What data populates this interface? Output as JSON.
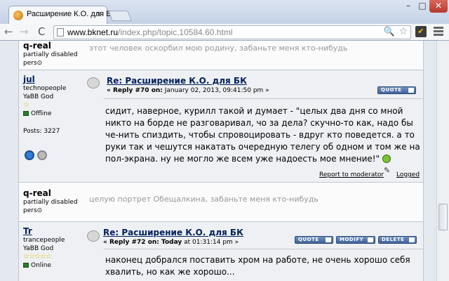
{
  "browser": {
    "tab_title": "Расширение К.О. для БК",
    "tab_close": "×",
    "win_min": "–",
    "win_max": "□",
    "win_close": "✕",
    "url_host": "www.bknet.ru",
    "url_path": "/index.php/topic,10584.60.html",
    "nav_back": "←",
    "nav_forward": "→",
    "nav_reload": "C",
    "zoom_glyph": "🔍",
    "star_glyph": "☆",
    "ext_glyph": "✔"
  },
  "posts": [
    {
      "username": "q-real",
      "line1": "partially disabled",
      "line2": "pers",
      "ignored_text": "этот человек оскорбил мою родину, забаньте меня кто-нибудь"
    },
    {
      "username": "jul",
      "rank": "technopeople",
      "group": "YaBB God",
      "stars": "☆",
      "status": "Offline",
      "posts_label": "Posts: 3227",
      "title": "Re: Расширение К.О. для БК",
      "reply_label": "« Reply #70 on:",
      "date": " January 02, 2013, 09:41:50 pm »",
      "quote_btn": "QUOTE",
      "body": "сидит, наверное, курилл такой и думает - \"целых два дня со мной никто на борде не разговаривал, чо за дела? скучно-то как, надо бы че-нить спиздить, чтобы спровоцировать - вдруг кто поведется. а то руки так и чешутся накатать очередную телегу об одном и том же на пол-экрана. ну не могло же всем уже надоесть мое мнение!\"",
      "report": "Report to moderator",
      "logged": "Logged"
    },
    {
      "username": "q-real",
      "line1": "partially disabled",
      "line2": "pers",
      "ignored_text": "целую портрет Обещалкина, забаньте меня кто-нибудь"
    },
    {
      "username": "Tr",
      "rank": "trancepeople",
      "group": "YaBB God",
      "stars": "☆☆☆☆☆",
      "status": "Online",
      "title": "Re: Расширение К.О. для БК",
      "reply_label": "« Reply #72 on:",
      "date_bold": " Today",
      "date": " at 01:31:14 pm »",
      "quote_btn": "QUOTE",
      "modify_btn": "MODIFY",
      "delete_btn": "DELETE",
      "body": "наконец добрался поставить хром на работе, не очень хорошо себя хвалить, но как же хорошо..."
    }
  ],
  "colors": {
    "link": "#00205c",
    "button": "#4f6fa6",
    "star": "#e5b800",
    "online": "#2a7a2a"
  }
}
